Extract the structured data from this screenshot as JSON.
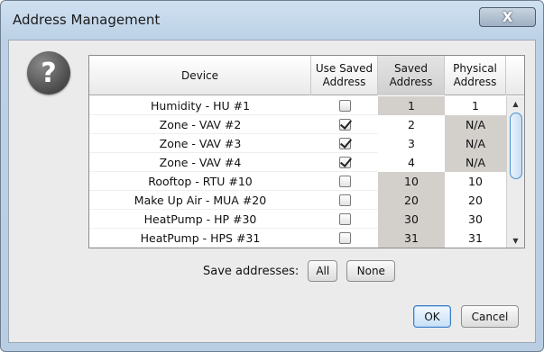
{
  "window": {
    "title": "Address Management",
    "close_label": "X"
  },
  "help_icon": {
    "icon": "question-icon",
    "glyph": "?"
  },
  "table": {
    "headers": {
      "device": "Device",
      "use_saved": "Use Saved\nAddress",
      "saved": "Saved\nAddress",
      "physical": "Physical\nAddress"
    },
    "rows": [
      {
        "device": "Humidity - HU #1",
        "use_saved": false,
        "saved": "1",
        "physical": "1",
        "saved_highlight": true,
        "physical_highlight": false
      },
      {
        "device": "Zone - VAV #2",
        "use_saved": true,
        "saved": "2",
        "physical": "N/A",
        "saved_highlight": false,
        "physical_highlight": true
      },
      {
        "device": "Zone - VAV #3",
        "use_saved": true,
        "saved": "3",
        "physical": "N/A",
        "saved_highlight": false,
        "physical_highlight": true
      },
      {
        "device": "Zone - VAV #4",
        "use_saved": true,
        "saved": "4",
        "physical": "N/A",
        "saved_highlight": false,
        "physical_highlight": true
      },
      {
        "device": "Rooftop - RTU #10",
        "use_saved": false,
        "saved": "10",
        "physical": "10",
        "saved_highlight": true,
        "physical_highlight": false
      },
      {
        "device": "Make Up Air - MUA #20",
        "use_saved": false,
        "saved": "20",
        "physical": "20",
        "saved_highlight": true,
        "physical_highlight": false
      },
      {
        "device": "HeatPump - HP #30",
        "use_saved": false,
        "saved": "30",
        "physical": "30",
        "saved_highlight": true,
        "physical_highlight": false
      },
      {
        "device": "HeatPump - HPS #31",
        "use_saved": false,
        "saved": "31",
        "physical": "31",
        "saved_highlight": true,
        "physical_highlight": false
      }
    ]
  },
  "save_addresses": {
    "label": "Save addresses:",
    "all_label": "All",
    "none_label": "None"
  },
  "footer": {
    "ok_label": "OK",
    "cancel_label": "Cancel"
  },
  "colors": {
    "highlight": "#d3d0cc",
    "accent": "#3b7fc4",
    "title_bar": "#bcd1e6"
  }
}
